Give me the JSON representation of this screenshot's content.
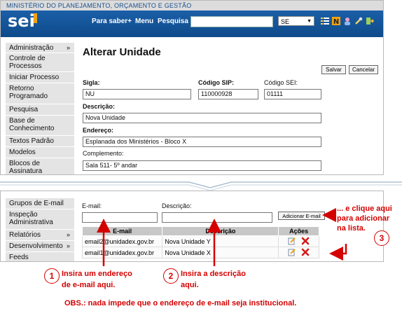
{
  "header": {
    "gov_bar": "MINISTÉRIO DO PLANEJAMENTO, ORÇAMENTO E GESTÃO",
    "logo": "sei",
    "links": [
      "Para saber+",
      "Menu",
      "Pesquisa"
    ],
    "search_value": "",
    "select_value": "SE"
  },
  "menu_top": [
    {
      "label": "Administração",
      "arrow": "»"
    },
    {
      "label": "Controle de Processos",
      "arrow": ""
    },
    {
      "label": "Iniciar Processo",
      "arrow": ""
    },
    {
      "label": "Retorno Programado",
      "arrow": ""
    },
    {
      "label": "Pesquisa",
      "arrow": ""
    },
    {
      "label": "Base de Conhecimento",
      "arrow": ""
    },
    {
      "label": "Textos Padrão",
      "arrow": ""
    },
    {
      "label": "Modelos",
      "arrow": ""
    },
    {
      "label": "Blocos de Assinatura",
      "arrow": ""
    }
  ],
  "menu_bottom": [
    {
      "label": "Grupos de E-mail",
      "arrow": ""
    },
    {
      "label": "Inspeção Administrativa",
      "arrow": ""
    },
    {
      "label": "Relatórios",
      "arrow": "»"
    },
    {
      "label": "Desenvolvimento",
      "arrow": "»"
    },
    {
      "label": "Feeds",
      "arrow": ""
    }
  ],
  "page": {
    "title": "Alterar Unidade",
    "save": "Salvar",
    "cancel": "Cancelar"
  },
  "form": {
    "sigla_label": "Sigla:",
    "sigla_value": "NU",
    "sip_label": "Código SIP:",
    "sip_value": "110000928",
    "sei_label": "Código SEI:",
    "sei_value": "01111",
    "descricao_label": "Descrição:",
    "descricao_value": "Nova Unidade",
    "endereco_label": "Endereço:",
    "endereco_value": "Esplanada dos Ministérios - Bloco X",
    "complemento_label": "Complemento:",
    "complemento_value": "Sala 511- 5º andar"
  },
  "email_section": {
    "email_label": "E-mail:",
    "email_value": "",
    "desc_label": "Descrição:",
    "desc_value": "",
    "add_button": "Adicionar E-mail",
    "columns": [
      "E-mail",
      "Descrição",
      "Ações"
    ],
    "rows": [
      {
        "email": "email2@unidadex.gov.br",
        "descricao": "Nova Unidade Y"
      },
      {
        "email": "email1@unidadex.gov.br",
        "descricao": "Nova Unidade X"
      }
    ]
  },
  "annotations": {
    "n1": "1",
    "n1_text_1": "Insira um endereço",
    "n1_text_2": "de e-mail aqui.",
    "n2": "2",
    "n2_text_1": "Insira a descrição",
    "n2_text_2": "aqui.",
    "n3": "3",
    "n3_text_1": "... e clique aqui",
    "n3_text_2": "para adicionar",
    "n3_text_3": "na lista.",
    "obs": "OBS.: nada impede que o endereço de e-mail seja institucional."
  },
  "colors": {
    "accent": "#0e4a8a",
    "annotation": "#d40000",
    "menu_bg": "#e4e4e4"
  }
}
